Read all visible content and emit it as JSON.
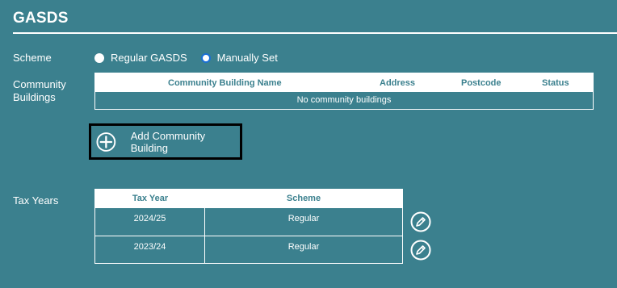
{
  "section": {
    "title": "GASDS"
  },
  "scheme": {
    "label": "Scheme",
    "options": [
      {
        "label": "Regular GASDS",
        "selected": false
      },
      {
        "label": "Manually Set",
        "selected": true
      }
    ]
  },
  "community_buildings": {
    "label": "Community Buildings",
    "columns": [
      "Community Building Name",
      "Address",
      "Postcode",
      "Status"
    ],
    "empty_text": "No community buildings",
    "add_button_label": "Add Community Building"
  },
  "tax_years": {
    "label": "Tax Years",
    "columns": [
      "Tax Year",
      "Scheme"
    ],
    "rows": [
      {
        "tax_year": "2024/25",
        "scheme": "Regular"
      },
      {
        "tax_year": "2023/24",
        "scheme": "Regular"
      }
    ]
  },
  "icons": {
    "add": "plus-circle-icon",
    "edit": "pencil-circle-icon"
  },
  "colors": {
    "background": "#3b808e",
    "text": "#ffffff",
    "radio_selected": "#1a6fd6",
    "focus_border": "#000000"
  }
}
